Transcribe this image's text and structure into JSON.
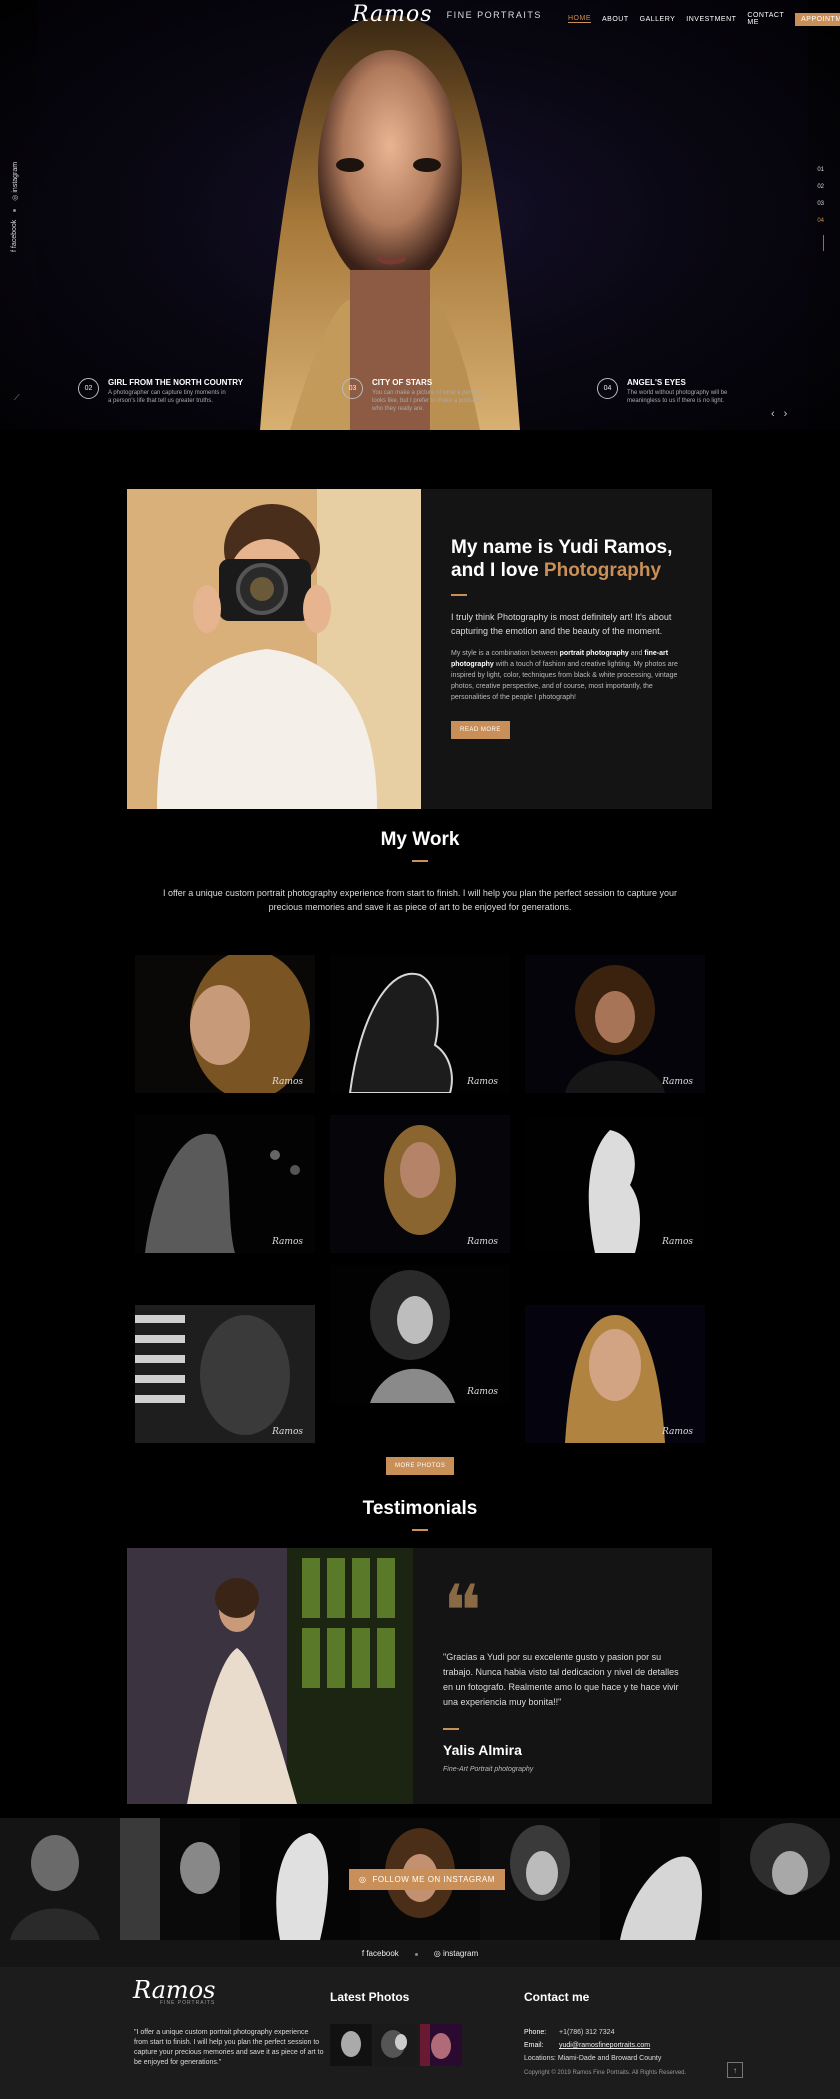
{
  "header": {
    "logo_script": "Ramos",
    "logo_sub": "FINE PORTRAITS",
    "nav": [
      "HOME",
      "ABOUT",
      "GALLERY",
      "INVESTMENT",
      "CONTACT ME"
    ],
    "cta": "APPOINTMENT"
  },
  "hero": {
    "social": [
      "facebook",
      "instagram"
    ],
    "pager": [
      "01",
      "02",
      "03",
      "04"
    ],
    "captions": [
      {
        "num": "02",
        "title": "GIRL FROM THE NORTH COUNTRY",
        "text": "A photographer can capture tiny moments in a person's life that tell us greater truths."
      },
      {
        "num": "03",
        "title": "CITY OF STARS",
        "text": "You can make a picture of what a person looks like, but I prefer to make a portrait of who they really are."
      },
      {
        "num": "04",
        "title": "ANGEL'S EYES",
        "text": "The world without photography will be meaningless to us if there is no light."
      }
    ]
  },
  "about": {
    "heading_line1": "My name is Yudi Ramos,",
    "heading_line2": "and I love ",
    "heading_accent": "Photography",
    "lead": "I truly think Photography is most definitely art! It's about capturing the emotion and the beauty of the moment.",
    "p_1": "My style is a combination between ",
    "p_bold1": "portrait photography",
    "p_2": " and ",
    "p_bold2": "fine-art photography",
    "p_3": " with a touch of fashion and creative lighting. My photos are inspired by light, color, techniques from black & white processing, vintage photos, creative perspective, and of course, most importantly, the personalities of the people I photograph!",
    "button": "READ MORE"
  },
  "work": {
    "title": "My Work",
    "intro": "I offer a unique custom portrait photography experience from start to finish. I will help you plan the perfect session to capture your precious memories and save it as piece of art to be enjoyed for generations.",
    "signature": "Ramos",
    "button": "MORE PHOTOS"
  },
  "testimonials": {
    "title": "Testimonials",
    "quote": "\"Gracias a Yudi por su excelente gusto y pasion por su trabajo. Nunca habia visto tal dedicacion y nivel de detalles en un fotografo. Realmente amo lo que hace y te hace vivir una experiencia muy bonita!!\"",
    "name": "Yalis Almira",
    "role": "Fine-Art Portrait photography"
  },
  "instagram": {
    "button": "FOLLOW ME ON INSTAGRAM"
  },
  "footer": {
    "social": [
      "facebook",
      "instagram"
    ],
    "logo_script": "Ramos",
    "logo_sub": "FINE PORTRAITS",
    "about": "\"I offer a unique custom portrait photography experience from start to finish. I will help you plan the perfect session to capture your precious memories and save it as piece of art to be enjoyed for generations.\"",
    "latest_title": "Latest Photos",
    "contact_title": "Contact me",
    "phone_label": "Phone:",
    "phone": "+1(786) 312 7324",
    "email_label": "Email:",
    "email": "yudi@ramosfineportraits.com",
    "locations_label": "Locations:",
    "locations": "Miami-Dade and Broward County",
    "copyright": "Copyright © 2019 Ramos Fine Portraits. All Rights Reserved."
  },
  "colors": {
    "accent": "#c98f58",
    "background": "#000000",
    "panel": "#141414",
    "footer": "#1c1c1c"
  }
}
